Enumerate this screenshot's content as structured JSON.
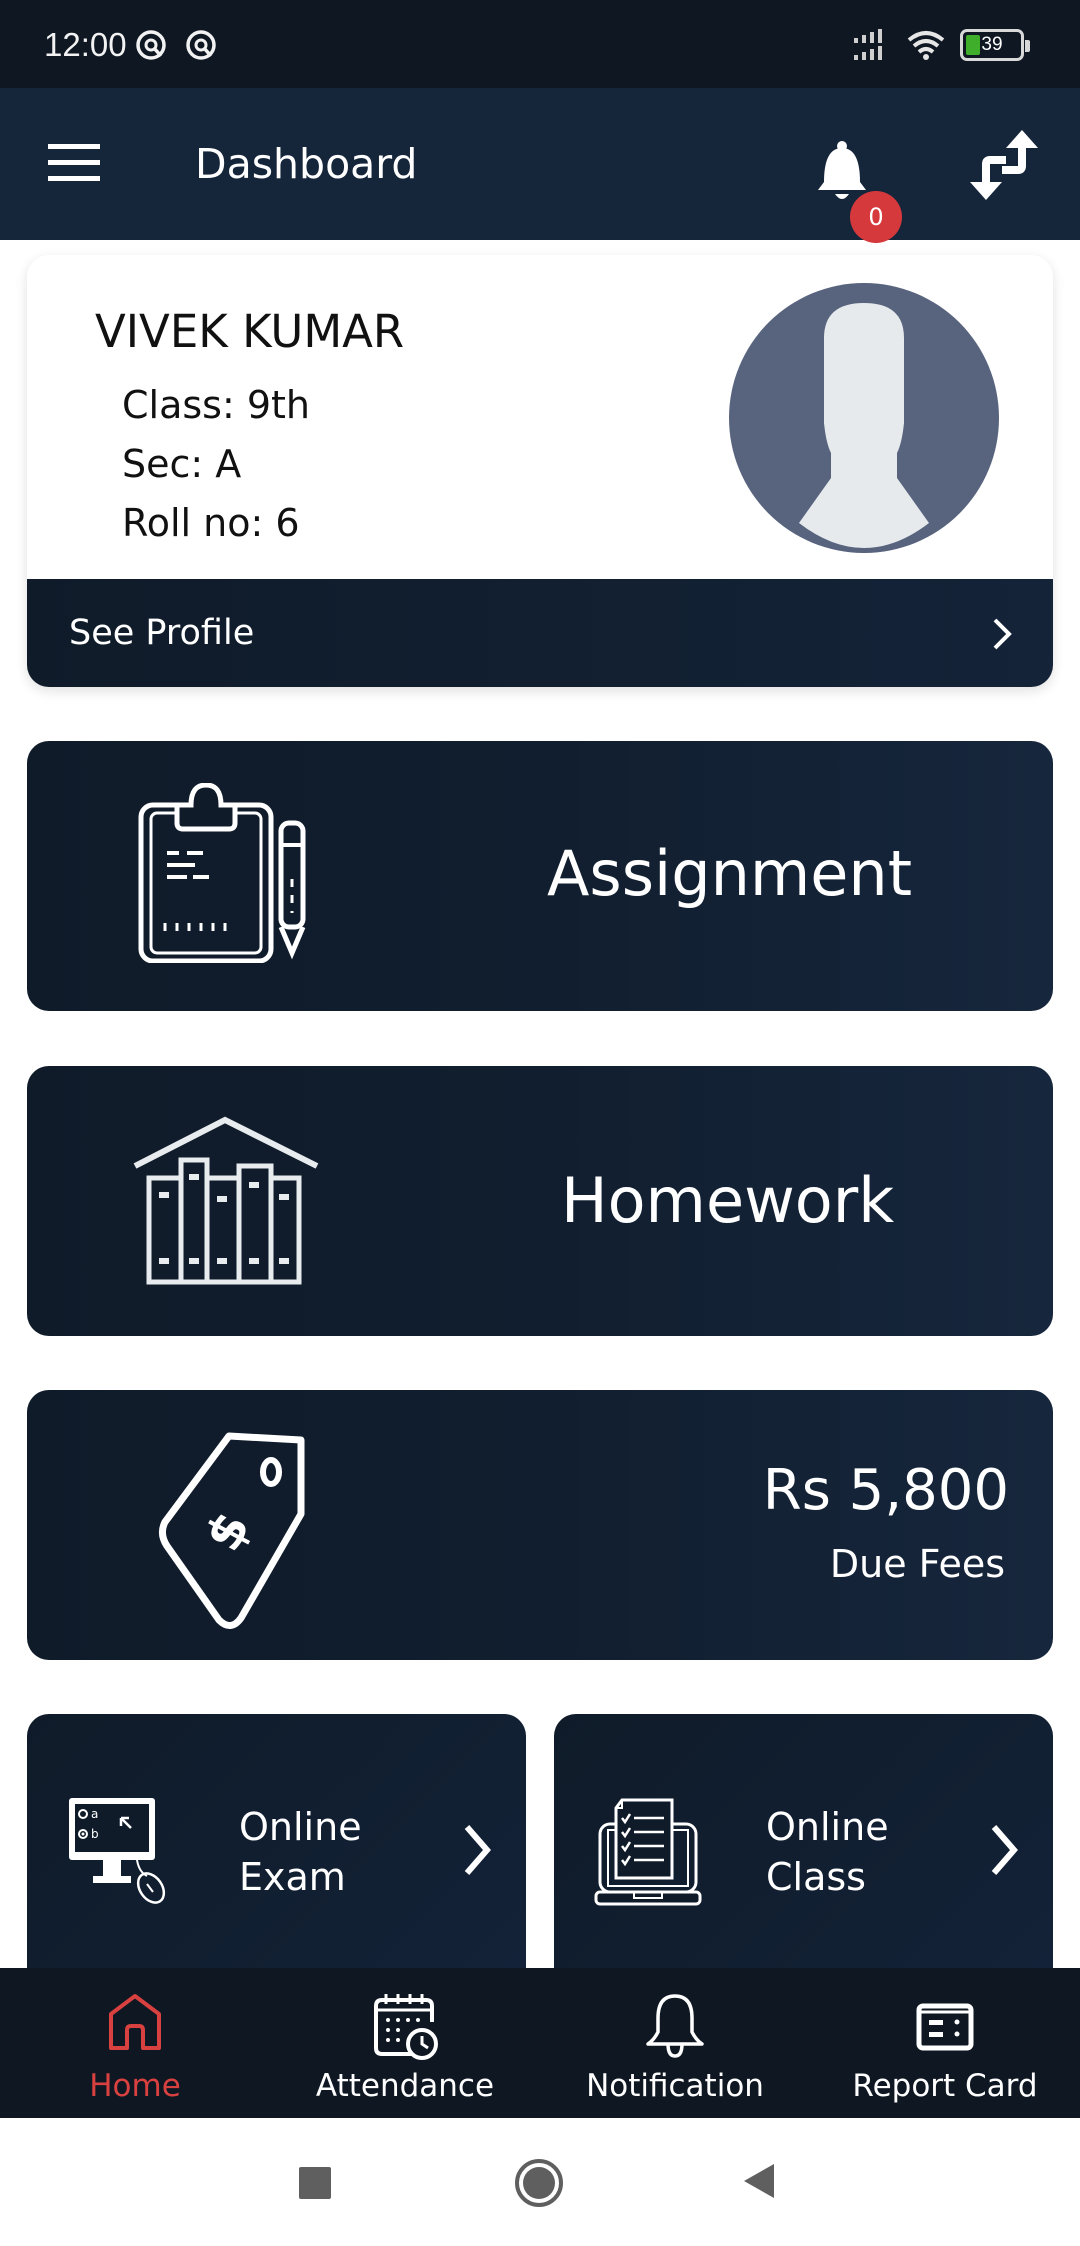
{
  "status_bar": {
    "time": "12:00",
    "battery_level": "39",
    "icons": [
      "at-sign-icon",
      "at-sign-icon",
      "cellular-signal-icon",
      "wifi-icon",
      "battery-icon"
    ]
  },
  "app_bar": {
    "title": "Dashboard",
    "notification_count": "0",
    "icons": [
      "menu-icon",
      "bell-icon",
      "switch-account-icon"
    ]
  },
  "profile": {
    "name": "VIVEK KUMAR",
    "class_line": "Class: 9th",
    "section_line": "Sec: A",
    "roll_line": "Roll no: 6",
    "see_profile_label": "See Profile"
  },
  "tiles": {
    "assignment": {
      "label": "Assignment",
      "icon": "clipboard-pencil-icon"
    },
    "homework": {
      "label": "Homework",
      "icon": "books-house-icon"
    },
    "fees": {
      "amount": "Rs 5,800",
      "label": "Due Fees",
      "icon": "price-tag-icon"
    },
    "online_exam": {
      "line1": "Online",
      "line2": "Exam",
      "icon": "computer-exam-icon"
    },
    "online_class": {
      "line1": "Online",
      "line2": "Class",
      "icon": "laptop-checklist-icon"
    }
  },
  "bottom_nav": {
    "items": [
      {
        "label": "Home",
        "icon": "home-icon",
        "active": true
      },
      {
        "label": "Attendance",
        "icon": "calendar-clock-icon",
        "active": false
      },
      {
        "label": "Notification",
        "icon": "bell-outline-icon",
        "active": false
      },
      {
        "label": "Report Card",
        "icon": "report-card-icon",
        "active": false
      }
    ]
  },
  "colors": {
    "primary_dark": "#0f1b29",
    "app_bar": "#16263a",
    "accent_red": "#d8413f",
    "badge_red": "#d6393c",
    "avatar_bg": "#58637e"
  }
}
